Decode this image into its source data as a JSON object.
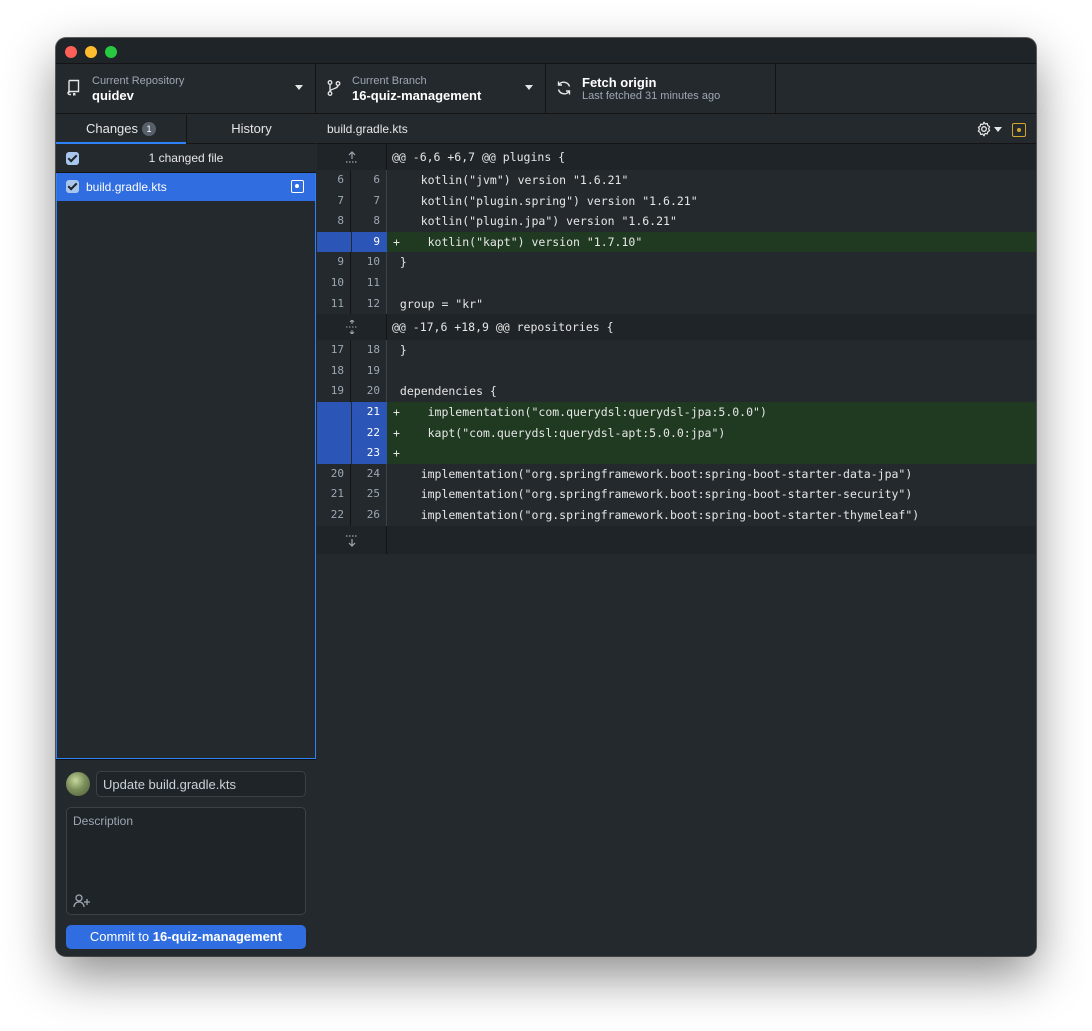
{
  "toolbar": {
    "repository": {
      "label": "Current Repository",
      "value": "quidev"
    },
    "branch": {
      "label": "Current Branch",
      "value": "16-quiz-management"
    },
    "fetch": {
      "label": "Fetch origin",
      "status": "Last fetched 31 minutes ago"
    }
  },
  "sidebar": {
    "tabs": {
      "changes_label": "Changes",
      "changes_count": "1",
      "history_label": "History"
    },
    "changed_header": "1 changed file",
    "files": [
      {
        "name": "build.gradle.kts",
        "status": "modified"
      }
    ],
    "commit": {
      "summary_value": "Update build.gradle.kts",
      "description_placeholder": "Description",
      "button_prefix": "Commit to ",
      "button_branch": "16-quiz-management"
    }
  },
  "diff": {
    "file_name": "build.gradle.kts",
    "hunk1": "@@ -6,6 +6,7 @@ plugins {",
    "hunk2": "@@ -17,6 +18,9 @@ repositories {",
    "lines": [
      {
        "old": "6",
        "new": "6",
        "text": "    kotlin(\"jvm\") version \"1.6.21\""
      },
      {
        "old": "7",
        "new": "7",
        "text": "    kotlin(\"plugin.spring\") version \"1.6.21\""
      },
      {
        "old": "8",
        "new": "8",
        "text": "    kotlin(\"plugin.jpa\") version \"1.6.21\""
      },
      {
        "old": "",
        "new": "9",
        "text": "+    kotlin(\"kapt\") version \"1.7.10\""
      },
      {
        "old": "9",
        "new": "10",
        "text": " }"
      },
      {
        "old": "10",
        "new": "11",
        "text": ""
      },
      {
        "old": "11",
        "new": "12",
        "text": " group = \"kr\""
      },
      {
        "old": "17",
        "new": "18",
        "text": " }"
      },
      {
        "old": "18",
        "new": "19",
        "text": ""
      },
      {
        "old": "19",
        "new": "20",
        "text": " dependencies {"
      },
      {
        "old": "",
        "new": "21",
        "text": "+    implementation(\"com.querydsl:querydsl-jpa:5.0.0\")"
      },
      {
        "old": "",
        "new": "22",
        "text": "+    kapt(\"com.querydsl:querydsl-apt:5.0.0:jpa\")"
      },
      {
        "old": "",
        "new": "23",
        "text": "+"
      },
      {
        "old": "20",
        "new": "24",
        "text": "    implementation(\"org.springframework.boot:spring-boot-starter-data-jpa\")"
      },
      {
        "old": "21",
        "new": "25",
        "text": "    implementation(\"org.springframework.boot:spring-boot-starter-security\")"
      },
      {
        "old": "22",
        "new": "26",
        "text": "    implementation(\"org.springframework.boot:spring-boot-starter-thymeleaf\")"
      }
    ]
  },
  "colors": {
    "accent": "#2f6de0",
    "added_bg": "#1f3a21",
    "modified_icon": "#d4a72c",
    "background": "#24292e"
  },
  "icons": [
    "repository-icon",
    "branch-icon",
    "sync-icon",
    "gear-icon",
    "modified-file-icon",
    "expand-up-icon",
    "expand-icon",
    "expand-down-icon",
    "add-coauthor-icon"
  ]
}
